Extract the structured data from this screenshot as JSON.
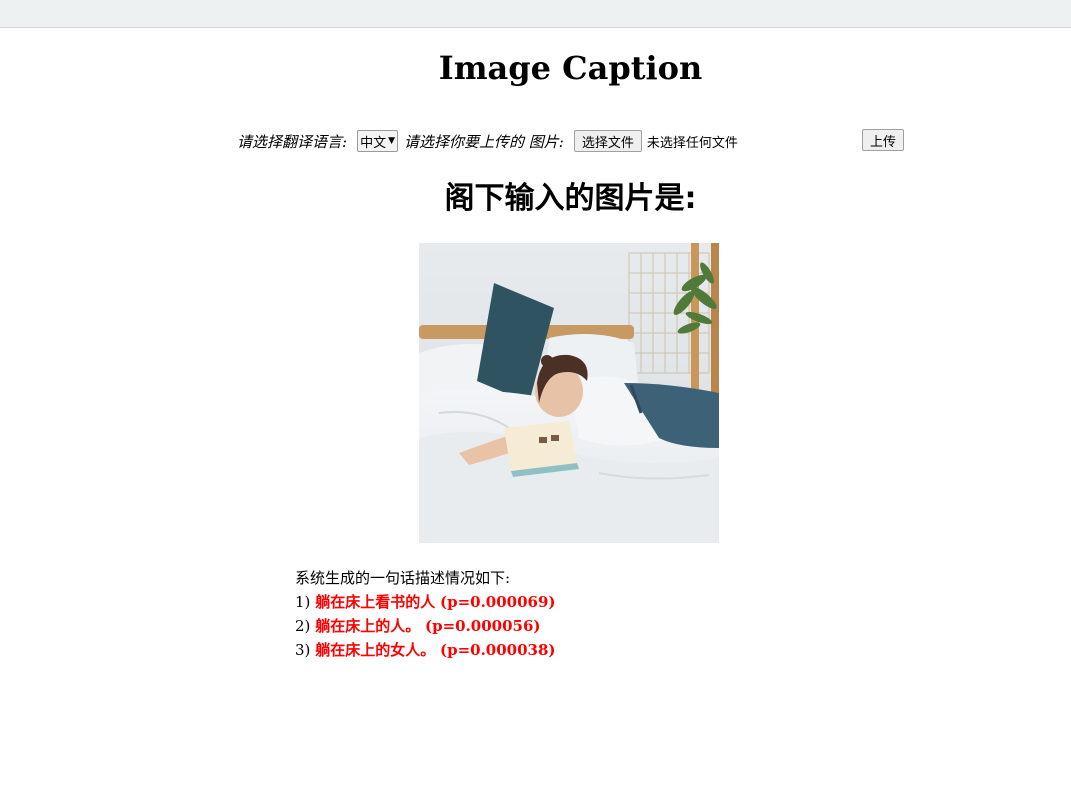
{
  "page": {
    "title": "Image Caption"
  },
  "form": {
    "language_label": "请选择翻译语言:",
    "language_selected": "中文",
    "file_label": "请选择你要上传的 图片:",
    "choose_file_button": "选择文件",
    "file_status": "未选择任何文件",
    "upload_button": "上传"
  },
  "output": {
    "heading": "阁下输入的图片是:",
    "image_alt": "woman lying on bed reading a book",
    "intro": "系统生成的一句话描述情况如下:",
    "results": [
      {
        "index": "1)",
        "caption": "躺在床上看书的人",
        "prob": "(p=0.000069)"
      },
      {
        "index": "2)",
        "caption": "躺在床上的人。",
        "prob": "(p=0.000056)"
      },
      {
        "index": "3)",
        "caption": "躺在床上的女人。",
        "prob": "(p=0.000038)"
      }
    ]
  },
  "colors": {
    "result_text": "#ff0000",
    "topbar": "#eef1f2"
  }
}
